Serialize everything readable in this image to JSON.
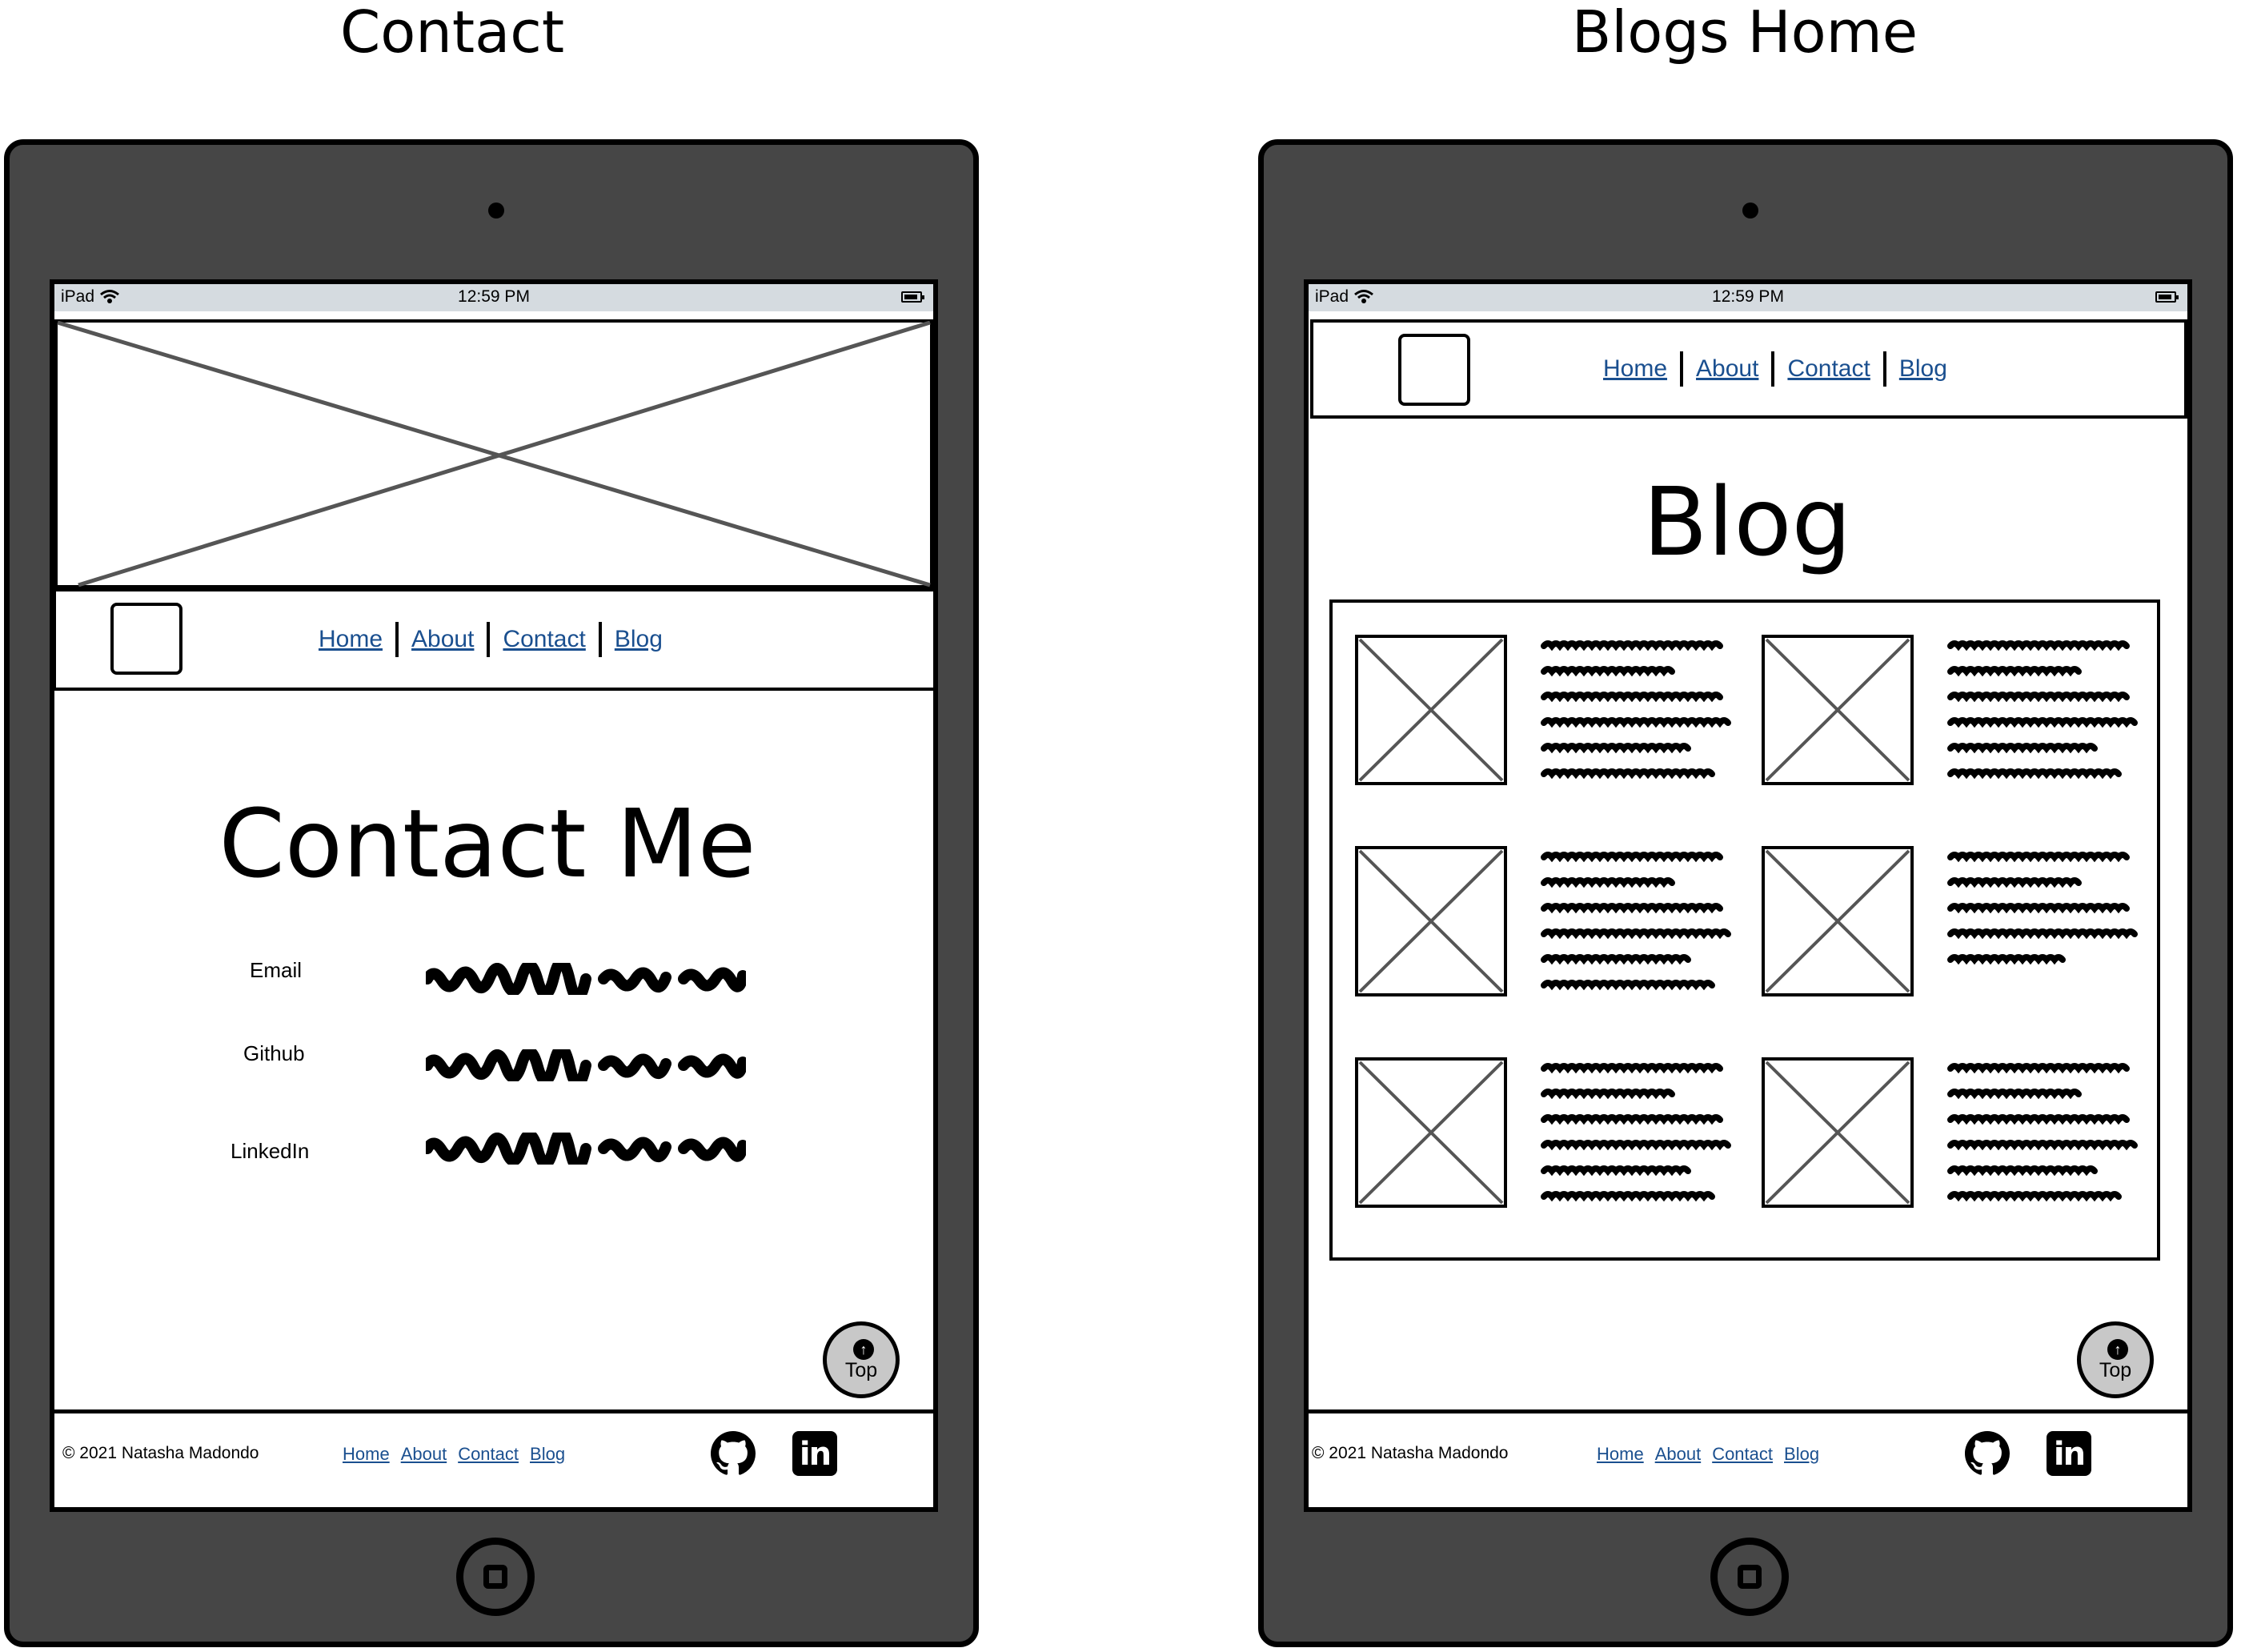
{
  "boards": [
    {
      "title": "Contact",
      "status": {
        "carrier": "iPad",
        "time": "12:59 PM"
      },
      "nav": [
        "Home",
        "About",
        "Contact",
        "Blog"
      ],
      "heading": "Contact Me",
      "contact_rows": [
        {
          "label": "Email"
        },
        {
          "label": "Github"
        },
        {
          "label": "LinkedIn"
        }
      ],
      "top_button": "Top",
      "footer": {
        "copyright": "© 2021 Natasha Madondo",
        "links": [
          "Home",
          "About",
          "Contact",
          "Blog"
        ]
      }
    },
    {
      "title": "Blogs Home",
      "status": {
        "carrier": "iPad",
        "time": "12:59 PM"
      },
      "nav": [
        "Home",
        "About",
        "Contact",
        "Blog"
      ],
      "heading": "Blog",
      "posts_count_shown": 6,
      "top_button": "Top",
      "footer": {
        "copyright": "© 2021 Natasha Madondo",
        "links": [
          "Home",
          "About",
          "Contact",
          "Blog"
        ]
      }
    }
  ],
  "icons": {
    "github": "github-icon",
    "linkedin": "linkedin-icon",
    "arrow_up": "arrow-up-circle-icon",
    "wifi": "wifi-icon",
    "battery": "battery-icon"
  },
  "colors": {
    "device": "#464646",
    "status_bar": "#d5dbe0",
    "link": "#1a4f8f",
    "top_button": "#c8c8c8"
  }
}
